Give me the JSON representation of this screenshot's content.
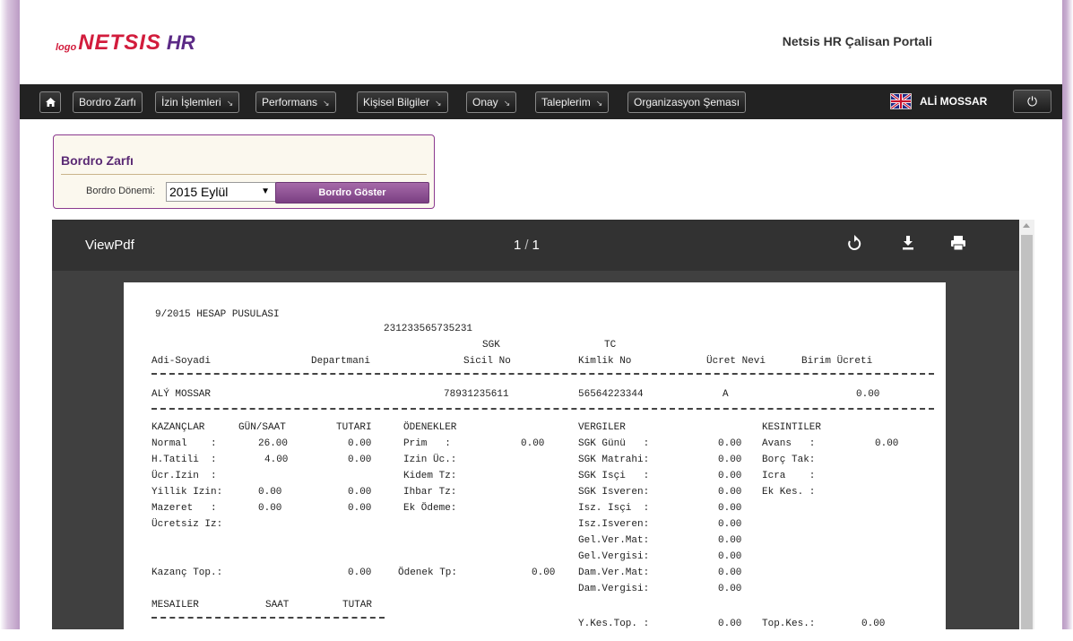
{
  "header": {
    "logo_prefix": "logo",
    "logo_main": "NETSIS",
    "logo_suffix": "HR",
    "portal_title": "Netsis HR Çalisan Portali"
  },
  "navbar": {
    "home_icon": "home-icon",
    "items": [
      {
        "label": "Bordro Zarfı",
        "dropdown": false
      },
      {
        "label": "İzin İşlemleri",
        "dropdown": true
      },
      {
        "label": "Performans",
        "dropdown": true
      },
      {
        "label": "Kişisel Bilgiler",
        "dropdown": true
      },
      {
        "label": "Onay",
        "dropdown": true
      },
      {
        "label": "Taleplerim",
        "dropdown": true
      },
      {
        "label": "Organizasyon Şeması",
        "dropdown": false
      }
    ],
    "language_icon": "uk-flag-icon",
    "user_name": "ALİ MOSSAR",
    "power_icon": "power-icon"
  },
  "bordro_panel": {
    "title": "Bordro Zarfı",
    "period_label": "Bordro Dönemi:",
    "period_value": "2015 Eylül",
    "show_button": "Bordro Göster"
  },
  "viewer": {
    "title": "ViewPdf",
    "current_page": "1",
    "total_pages": "1",
    "icons": [
      "rotate-icon",
      "download-icon",
      "print-icon"
    ]
  },
  "payslip": {
    "title": "9/2015 HESAP PUSULASI",
    "id_number": "231233565735231",
    "headers": {
      "adi_soyadi": "Adi-Soyadi",
      "departmani": "Departmani",
      "sgk": "SGK",
      "sicil_no": "Sicil No",
      "tc": "TC",
      "kimlik_no": "Kimlik No",
      "ucret_nevi": "Ücret Nevi",
      "birim_ucreti": "Birim Ücreti"
    },
    "employee": {
      "name": "ALÝ MOSSAR",
      "sicil_no": "78931235611",
      "kimlik_no": "56564223344",
      "ucret_nevi": "A",
      "birim_ucreti": "0.00"
    },
    "kazanclar": {
      "header": "KAZANÇLAR",
      "gun_saat_header": "GÜN/SAAT",
      "tutari_header": "TUTARI",
      "rows": [
        {
          "label": "Normal    :",
          "gun": "26.00",
          "tutar": "0.00"
        },
        {
          "label": "H.Tatili  :",
          "gun": "4.00",
          "tutar": "0.00"
        },
        {
          "label": "Ücr.Izin  :",
          "gun": "",
          "tutar": ""
        },
        {
          "label": "Yillik Izin:",
          "gun": "0.00",
          "tutar": "0.00"
        },
        {
          "label": "Mazeret   :",
          "gun": "0.00",
          "tutar": "0.00"
        },
        {
          "label": "Ücretsiz Iz:",
          "gun": "",
          "tutar": ""
        }
      ],
      "total_label": "Kazanç Top.:",
      "total_value": "0.00"
    },
    "odenekler": {
      "header": "ÖDENEKLER",
      "rows": [
        {
          "label": "Prim   :",
          "value": "0.00"
        },
        {
          "label": "Izin Üc.:",
          "value": ""
        },
        {
          "label": "Kidem Tz:",
          "value": ""
        },
        {
          "label": "Ihbar Tz:",
          "value": ""
        },
        {
          "label": "Ek Ödeme:",
          "value": ""
        }
      ],
      "total_label": "Ödenek Tp:",
      "total_value": "0.00"
    },
    "vergiler": {
      "header": "VERGILER",
      "rows": [
        {
          "label": "SGK Günü   :",
          "value": "0.00"
        },
        {
          "label": "SGK Matrahi:",
          "value": "0.00"
        },
        {
          "label": "SGK Isçi   :",
          "value": "0.00"
        },
        {
          "label": "SGK Isveren:",
          "value": "0.00"
        },
        {
          "label": "Isz. Isçi  :",
          "value": "0.00"
        },
        {
          "label": "Isz.Isveren:",
          "value": "0.00"
        },
        {
          "label": "Gel.Ver.Mat:",
          "value": "0.00"
        },
        {
          "label": "Gel.Vergisi:",
          "value": "0.00"
        },
        {
          "label": "Dam.Ver.Mat:",
          "value": "0.00"
        },
        {
          "label": "Dam.Vergisi:",
          "value": "0.00"
        },
        {
          "label": "Y.Kes.Top. :",
          "value": "0.00"
        }
      ]
    },
    "kesintiler": {
      "header": "KESINTILER",
      "rows": [
        {
          "label": "Avans   :",
          "value": "0.00"
        },
        {
          "label": "Borç Tak:",
          "value": ""
        },
        {
          "label": "Icra    :",
          "value": ""
        },
        {
          "label": "Ek Kes. :",
          "value": ""
        }
      ],
      "total_label": "Top.Kes.:",
      "total_value": "0.00"
    },
    "mesailer": {
      "header": "MESAILER",
      "saat_header": "SAAT",
      "tutar_header": "TUTAR"
    }
  }
}
